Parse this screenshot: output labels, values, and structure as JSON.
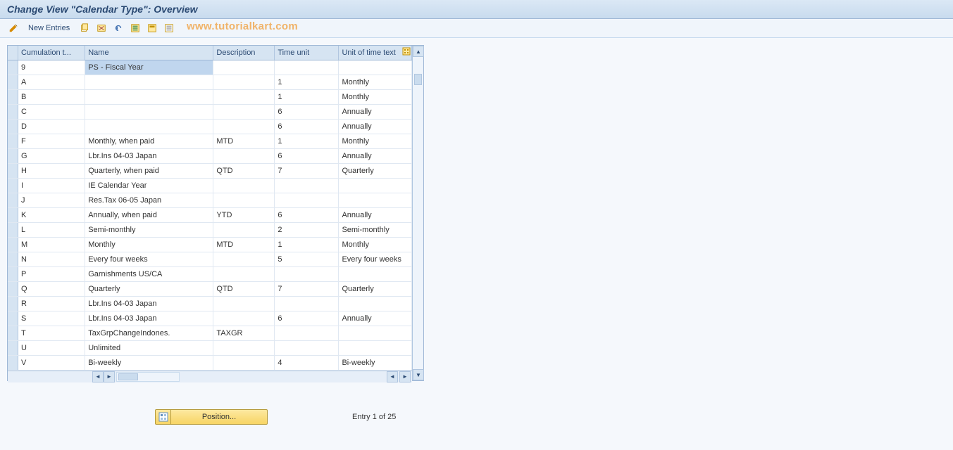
{
  "title": "Change View \"Calendar Type\": Overview",
  "watermark": "www.tutorialkart.com",
  "toolbar": {
    "new_entries_label": "New Entries"
  },
  "table": {
    "columns": {
      "cumulation_type": "Cumulation t...",
      "name": "Name",
      "description": "Description",
      "time_unit": "Time unit",
      "unit_of_time_text": "Unit of time text"
    },
    "rows": [
      {
        "ct": "9",
        "name": "PS - Fiscal Year",
        "desc": "",
        "tu": "",
        "ut": "",
        "selected": true
      },
      {
        "ct": "A",
        "name": "",
        "desc": "",
        "tu": "1",
        "ut": "Monthly"
      },
      {
        "ct": "B",
        "name": "",
        "desc": "",
        "tu": "1",
        "ut": "Monthly"
      },
      {
        "ct": "C",
        "name": "",
        "desc": "",
        "tu": "6",
        "ut": "Annually"
      },
      {
        "ct": "D",
        "name": "",
        "desc": "",
        "tu": "6",
        "ut": "Annually"
      },
      {
        "ct": "F",
        "name": "Monthly, when paid",
        "desc": "MTD",
        "tu": "1",
        "ut": "Monthly"
      },
      {
        "ct": "G",
        "name": "Lbr.Ins 04-03  Japan",
        "desc": "",
        "tu": "6",
        "ut": "Annually"
      },
      {
        "ct": "H",
        "name": "Quarterly, when paid",
        "desc": "QTD",
        "tu": "7",
        "ut": "Quarterly"
      },
      {
        "ct": "I",
        "name": "IE Calendar Year",
        "desc": "",
        "tu": "",
        "ut": ""
      },
      {
        "ct": "J",
        "name": "Res.Tax 06-05  Japan",
        "desc": "",
        "tu": "",
        "ut": ""
      },
      {
        "ct": "K",
        "name": "Annually, when paid",
        "desc": "YTD",
        "tu": "6",
        "ut": "Annually"
      },
      {
        "ct": "L",
        "name": "Semi-monthly",
        "desc": "",
        "tu": "2",
        "ut": "Semi-monthly"
      },
      {
        "ct": "M",
        "name": "Monthly",
        "desc": "MTD",
        "tu": "1",
        "ut": "Monthly"
      },
      {
        "ct": "N",
        "name": "Every four weeks",
        "desc": "",
        "tu": "5",
        "ut": "Every four weeks"
      },
      {
        "ct": "P",
        "name": "Garnishments US/CA",
        "desc": "",
        "tu": "",
        "ut": ""
      },
      {
        "ct": "Q",
        "name": "Quarterly",
        "desc": "QTD",
        "tu": "7",
        "ut": "Quarterly"
      },
      {
        "ct": "R",
        "name": "Lbr.Ins 04-03  Japan",
        "desc": "",
        "tu": "",
        "ut": ""
      },
      {
        "ct": "S",
        "name": "Lbr.Ins 04-03  Japan",
        "desc": "",
        "tu": "6",
        "ut": "Annually"
      },
      {
        "ct": "T",
        "name": "TaxGrpChangeIndones.",
        "desc": "TAXGR",
        "tu": "",
        "ut": ""
      },
      {
        "ct": "U",
        "name": "Unlimited",
        "desc": "",
        "tu": "",
        "ut": ""
      },
      {
        "ct": "V",
        "name": "Bi-weekly",
        "desc": "",
        "tu": "4",
        "ut": "Bi-weekly"
      }
    ]
  },
  "footer": {
    "position_label": "Position...",
    "entry_text": "Entry 1 of 25"
  }
}
